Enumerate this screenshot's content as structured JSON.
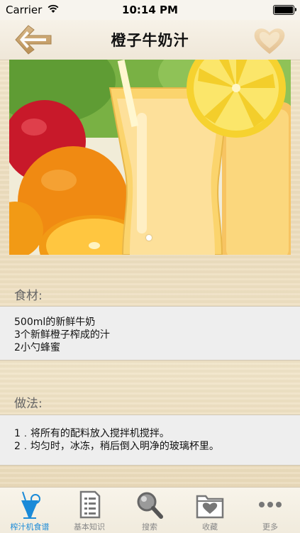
{
  "status_bar": {
    "carrier": "Carrier",
    "time": "10:14 PM"
  },
  "nav": {
    "title": "橙子牛奶汁",
    "back_icon": "back-arrow-icon",
    "favorite_icon": "heart-icon"
  },
  "hero": {
    "pages": 1,
    "current_page": 1
  },
  "ingredients": {
    "label": "食材:",
    "lines": [
      "500ml的新鲜牛奶",
      "3个新鲜橙子榨成的汁",
      "2小勺蜂蜜"
    ]
  },
  "method": {
    "label": "做法:",
    "lines": [
      "1﹒将所有的配料放入搅拌机搅拌。",
      "2﹒均匀时，冰冻，稍后倒入明净的玻璃杯里。"
    ]
  },
  "tabs": [
    {
      "label": "榨汁机食谱",
      "icon": "juice-glass-icon",
      "active": true
    },
    {
      "label": "基本知识",
      "icon": "document-icon",
      "active": false
    },
    {
      "label": "搜索",
      "icon": "magnifier-icon",
      "active": false
    },
    {
      "label": "收藏",
      "icon": "heart-folder-icon",
      "active": false
    },
    {
      "label": "更多",
      "icon": "more-dots-icon",
      "active": false
    }
  ],
  "colors": {
    "active_tab": "#1a8ad8",
    "inactive_tab": "#888888",
    "panel_bg": "#eeeeee"
  }
}
